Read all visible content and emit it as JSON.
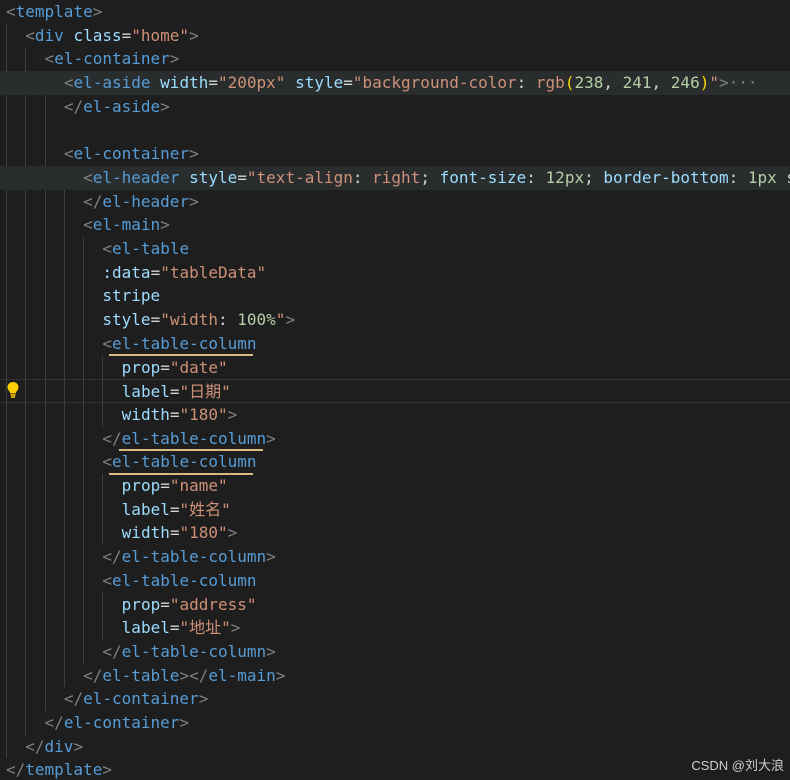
{
  "watermark": "CSDN @刘大浪",
  "lines": [
    [
      [
        "c-br",
        "<"
      ],
      [
        "c-tag",
        "template"
      ],
      [
        "c-br",
        ">"
      ]
    ],
    [
      [
        "c-br",
        "<"
      ],
      [
        "c-tag",
        "div"
      ],
      [
        "c-txt",
        " "
      ],
      [
        "c-attr",
        "class"
      ],
      [
        "c-txt",
        "="
      ],
      [
        "c-str",
        "\"home\""
      ],
      [
        "c-br",
        ">"
      ]
    ],
    [
      [
        "c-br",
        "<"
      ],
      [
        "c-tag",
        "el-container"
      ],
      [
        "c-br",
        ">"
      ]
    ],
    [
      [
        "c-br",
        "<"
      ],
      [
        "c-tag",
        "el-aside"
      ],
      [
        "c-txt",
        " "
      ],
      [
        "c-attr",
        "width"
      ],
      [
        "c-txt",
        "="
      ],
      [
        "c-str",
        "\"200px\""
      ],
      [
        "c-txt",
        " "
      ],
      [
        "c-attr",
        "style"
      ],
      [
        "c-txt",
        "="
      ],
      [
        "c-str",
        "\"background-color"
      ],
      [
        "c-txt",
        ": "
      ],
      [
        "c-str",
        "rgb"
      ],
      [
        "c-bracket1",
        "("
      ],
      [
        "c-num",
        "238"
      ],
      [
        "c-txt",
        ", "
      ],
      [
        "c-num",
        "241"
      ],
      [
        "c-txt",
        ", "
      ],
      [
        "c-num",
        "246"
      ],
      [
        "c-bracket1",
        ")"
      ],
      [
        "c-str",
        "\""
      ],
      [
        "c-br",
        ">"
      ],
      [
        "c-ellipsis",
        "···"
      ]
    ],
    [
      [
        "c-br",
        "</"
      ],
      [
        "c-tag",
        "el-aside"
      ],
      [
        "c-br",
        ">"
      ]
    ],
    [],
    [
      [
        "c-br",
        "<"
      ],
      [
        "c-tag",
        "el-container"
      ],
      [
        "c-br",
        ">"
      ]
    ],
    [
      [
        "c-br",
        "<"
      ],
      [
        "c-tag",
        "el-header"
      ],
      [
        "c-txt",
        " "
      ],
      [
        "c-attr",
        "style"
      ],
      [
        "c-txt",
        "="
      ],
      [
        "c-str",
        "\"text-align"
      ],
      [
        "c-txt",
        ": "
      ],
      [
        "c-str",
        "right"
      ],
      [
        "c-txt",
        "; "
      ],
      [
        "c-attr",
        "font-size"
      ],
      [
        "c-txt",
        ": "
      ],
      [
        "c-num",
        "12px"
      ],
      [
        "c-txt",
        "; "
      ],
      [
        "c-attr",
        "border-bottom"
      ],
      [
        "c-txt",
        ": "
      ],
      [
        "c-num",
        "1px"
      ],
      [
        "c-txt",
        " s"
      ]
    ],
    [
      [
        "c-br",
        "</"
      ],
      [
        "c-tag",
        "el-header"
      ],
      [
        "c-br",
        ">"
      ]
    ],
    [
      [
        "c-br",
        "<"
      ],
      [
        "c-tag",
        "el-main"
      ],
      [
        "c-br",
        ">"
      ]
    ],
    [
      [
        "c-br",
        "<"
      ],
      [
        "c-tag",
        "el-table"
      ]
    ],
    [
      [
        "c-attr",
        ":data"
      ],
      [
        "c-txt",
        "="
      ],
      [
        "c-str",
        "\"tableData\""
      ]
    ],
    [
      [
        "c-attr",
        "stripe"
      ]
    ],
    [
      [
        "c-attr",
        "style"
      ],
      [
        "c-txt",
        "="
      ],
      [
        "c-str",
        "\"width"
      ],
      [
        "c-txt",
        ": "
      ],
      [
        "c-num",
        "100%"
      ],
      [
        "c-str",
        "\""
      ],
      [
        "c-br",
        ">"
      ]
    ],
    [
      [
        "c-br",
        "<"
      ],
      [
        "c-tag",
        "el-table-column"
      ]
    ],
    [
      [
        "c-attr",
        "prop"
      ],
      [
        "c-txt",
        "="
      ],
      [
        "c-str",
        "\"date\""
      ]
    ],
    [
      [
        "c-attr",
        "label"
      ],
      [
        "c-txt",
        "="
      ],
      [
        "c-str",
        "\"日期\""
      ]
    ],
    [
      [
        "c-attr",
        "width"
      ],
      [
        "c-txt",
        "="
      ],
      [
        "c-str",
        "\"180\""
      ],
      [
        "c-br",
        ">"
      ]
    ],
    [
      [
        "c-br",
        "</"
      ],
      [
        "c-tag",
        "el-table-column"
      ],
      [
        "c-br",
        ">"
      ]
    ],
    [
      [
        "c-br",
        "<"
      ],
      [
        "c-tag",
        "el-table-column"
      ]
    ],
    [
      [
        "c-attr",
        "prop"
      ],
      [
        "c-txt",
        "="
      ],
      [
        "c-str",
        "\"name\""
      ]
    ],
    [
      [
        "c-attr",
        "label"
      ],
      [
        "c-txt",
        "="
      ],
      [
        "c-str",
        "\"姓名\""
      ]
    ],
    [
      [
        "c-attr",
        "width"
      ],
      [
        "c-txt",
        "="
      ],
      [
        "c-str",
        "\"180\""
      ],
      [
        "c-br",
        ">"
      ]
    ],
    [
      [
        "c-br",
        "</"
      ],
      [
        "c-tag",
        "el-table-column"
      ],
      [
        "c-br",
        ">"
      ]
    ],
    [
      [
        "c-br",
        "<"
      ],
      [
        "c-tag",
        "el-table-column"
      ]
    ],
    [
      [
        "c-attr",
        "prop"
      ],
      [
        "c-txt",
        "="
      ],
      [
        "c-str",
        "\"address\""
      ]
    ],
    [
      [
        "c-attr",
        "label"
      ],
      [
        "c-txt",
        "="
      ],
      [
        "c-str",
        "\"地址\""
      ],
      [
        "c-br",
        ">"
      ]
    ],
    [
      [
        "c-br",
        "</"
      ],
      [
        "c-tag",
        "el-table-column"
      ],
      [
        "c-br",
        ">"
      ]
    ],
    [
      [
        "c-br",
        "</"
      ],
      [
        "c-tag",
        "el-table"
      ],
      [
        "c-br",
        "></"
      ],
      [
        "c-tag",
        "el-main"
      ],
      [
        "c-br",
        ">"
      ]
    ],
    [
      [
        "c-br",
        "</"
      ],
      [
        "c-tag",
        "el-container"
      ],
      [
        "c-br",
        ">"
      ]
    ],
    [
      [
        "c-br",
        "</"
      ],
      [
        "c-tag",
        "el-container"
      ],
      [
        "c-br",
        ">"
      ]
    ],
    [
      [
        "c-br",
        "</"
      ],
      [
        "c-tag",
        "div"
      ],
      [
        "c-br",
        ">"
      ]
    ],
    [
      [
        "c-br",
        "</"
      ],
      [
        "c-tag",
        "template"
      ],
      [
        "c-br",
        ">"
      ]
    ]
  ]
}
